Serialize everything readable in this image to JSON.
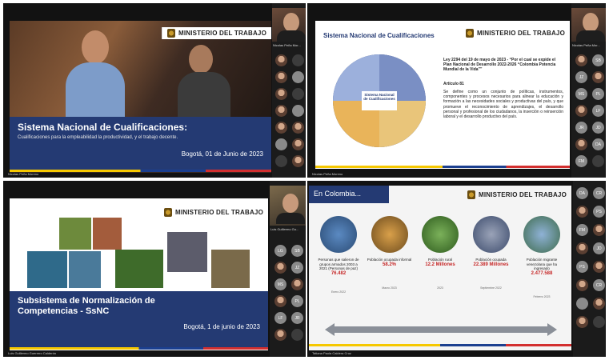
{
  "ministry": "MINISTERIO DEL TRABAJO",
  "panel1": {
    "title": "Sistema Nacional de Cualificaciones:",
    "subtitle": "Cualificaciones para la empleabilidad la productividad, y el trabajo decente.",
    "date": "Bogotá, 01 de Junio de 2023",
    "presenter": "Nicolas Peña Moreno",
    "cam_name": "Nicolas Peña Mor..."
  },
  "panel2": {
    "header": "Sistema Nacional de Cualificaciones",
    "law": "Ley 2294 del 19 de mayo de 2023 - “Por el cual se expide el Plan Nacional de Desarrollo 2022-2026 “Colombia Potencia Mundial de la Vida””",
    "article": "Artículo 81",
    "body": "Se define como un conjunto de políticas, instrumentos, componentes y procesos necesarios para alinear la educación y formación a las necesidades sociales y productivas del país, y que promueve el reconocimiento de aprendizajes, el desarrollo personal y profesional de los ciudadanos, la inserción o reinserción laboral y el desarrollo productivo del país.",
    "center_label": "Sistema Nacional de Cualificaciones",
    "presenter": "Nicolas Peña Moreno",
    "cam_name": "Nicolas Peña Mor..."
  },
  "panel3": {
    "title": "Subsistema de Normalización de Competencias - SsNC",
    "date": "Bogotá, 1 de junio de 2023",
    "presenter": "Luis Guillermo Guerrero Calderón",
    "cam_name": "Luis Guillermo Gu..."
  },
  "panel4": {
    "title": "En Colombia...",
    "presenter": "Tatiana Paola Caldera Cruz",
    "stats": [
      {
        "label": "Personas que salieron de grupos armados 2003 a 2021 (Personas de paz)",
        "value": "76.482"
      },
      {
        "label": "Población ocupada informal",
        "value": "58.2%"
      },
      {
        "label": "Población rural",
        "value": "12.2 Millones"
      },
      {
        "label": "Población ocupada",
        "value": "22.389 Millones"
      },
      {
        "label": "Población migrante venezolana que ha ingresado",
        "value": "2.477.588"
      }
    ],
    "footnotes": [
      "Enero 2022",
      "Marzo 2023",
      "2023",
      "Septiembre 2022",
      "Febrero 2023"
    ]
  },
  "side_initials_right": [
    "SB",
    "JZ",
    "MS",
    "PL",
    "LF",
    "JR",
    "JD",
    "DA",
    "FM",
    "PS",
    "CR"
  ],
  "side_initials_left": [
    "LG",
    "SB",
    "JZ",
    "MS",
    "PL",
    "LF",
    "JR",
    "DA",
    "CR",
    "PS",
    "FM",
    "JD"
  ]
}
